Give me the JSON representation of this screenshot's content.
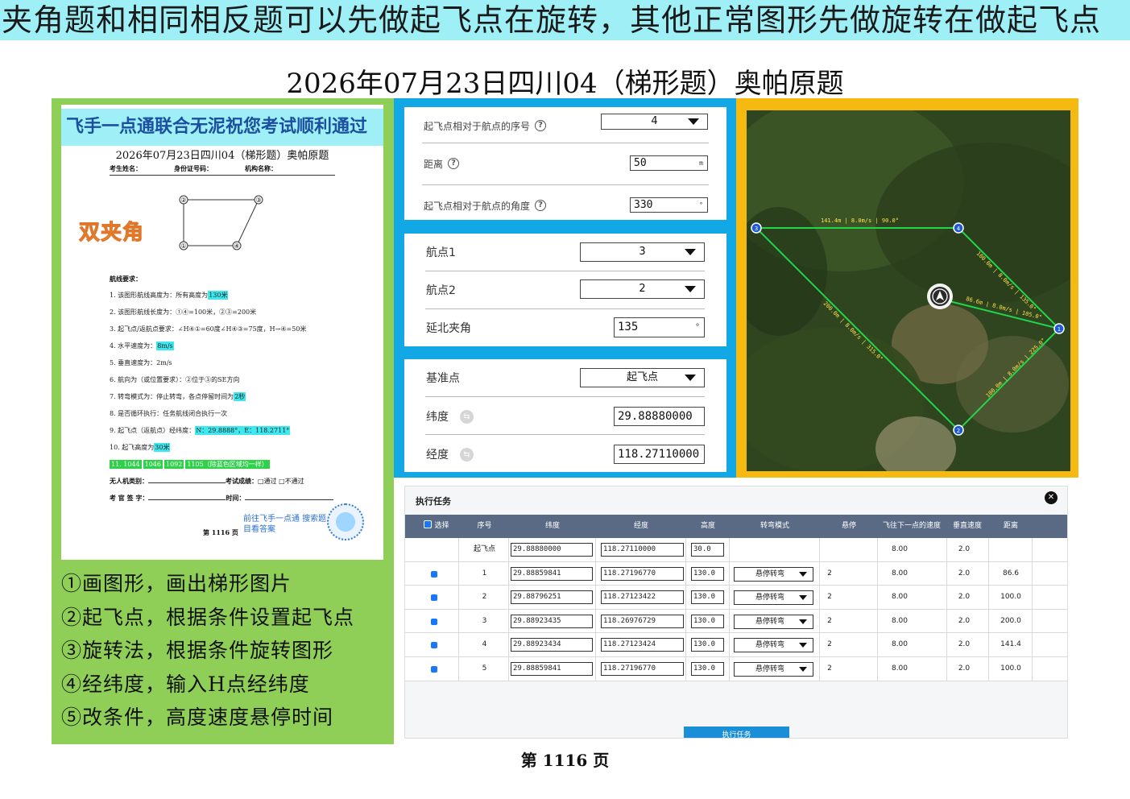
{
  "banner": "夹角题和相同相反题可以先做起飞点在旋转，其他正常图形先做旋转在做起飞点",
  "main_title": "2026年07月23日四川04（梯形题）奥帕原题",
  "doc": {
    "header": "飞手一点通联合无泥祝您考试顺利通过",
    "title": "2026年07月23日四川04（梯形题）奥帕原题",
    "field_name": "考生姓名：",
    "field_id": "身份证号码：",
    "field_org": "机构名称：",
    "badge": "双夹角",
    "shape_labels": [
      "②",
      "③",
      "①",
      "④"
    ],
    "req_title": "航线要求：",
    "req": {
      "r1_a": "1.  该图形航线高度为：所有高度为",
      "r1_hl": "130米",
      "r2": "2.  该图形航线长度为：①④=100米，②③=200米",
      "r3": "3.  起飞点/返航点要求：∠H④①=60度∠H④③=75度，H→④=50米",
      "r4_a": "4.  水平速度为：",
      "r4_hl": "8m/s",
      "r5": "5.  垂直速度为：2m/s",
      "r6": "6.  航向为（或位置要求）：②位于③的SE方向",
      "r7_a": "7.  转弯模式为：停止转弯，各点停留时间为",
      "r7_hl": "2秒",
      "r8": "8.  是否循环执行：任务航线闭合执行一次",
      "r9_a": "9.  起飞点（返航点）经纬度：",
      "r9_hl": "N：29.8888°，E：118.2711°",
      "r10_a": "10. 起飞高度为",
      "r10_hl": "30米",
      "r11": [
        "11. 1044",
        "1046",
        "1092",
        "1105（除蓝色区域均一样）"
      ]
    },
    "sign1_a": "无人机类别：",
    "sign1_b": "考试成绩：",
    "sign1_c": "□通过  □不通过",
    "sign2_a": "考 官 签 字：",
    "sign2_b": "时间：",
    "page_label": "第 1116 页",
    "link_text": "前往飞手一点通 搜索题目看答案"
  },
  "steps": [
    "①画图形，画出梯形图片",
    "②起飞点，根据条件设置起飞点",
    "③旋转法，根据条件旋转图形",
    "④经纬度，输入H点经纬度",
    "⑤改条件，高度速度悬停时间"
  ],
  "panel1": {
    "seq_label": "起飞点相对于航点的序号",
    "seq_value": "4",
    "dist_label": "距离",
    "dist_value": "50",
    "dist_unit": "m",
    "angle_label": "起飞点相对于航点的角度",
    "angle_value": "330",
    "angle_unit": "°"
  },
  "panel2": {
    "wp1_label": "航点1",
    "wp1_value": "3",
    "wp2_label": "航点2",
    "wp2_value": "2",
    "north_label": "延北夹角",
    "north_value": "135",
    "north_unit": "°"
  },
  "panel3": {
    "base_label": "基准点",
    "base_value": "起飞点",
    "lat_label": "纬度",
    "lat_value": "29.88880000",
    "lon_label": "经度",
    "lon_value": "118.27110000"
  },
  "map": {
    "labels": {
      "e34": "141.4m | 8.0m/s | 90.0°",
      "e41": "100.0m | 8.0m/s | 135.0°",
      "eH1": "86.6m | 8.0m/s | 105.0°",
      "e32": "200.0m | 8.0m/s | 315.0°",
      "e21": "100.0m | 8.0m/s | 225.0°"
    },
    "nodes": [
      "3",
      "4",
      "1",
      "2"
    ]
  },
  "task": {
    "title": "执行任务",
    "close": "✕",
    "headers": [
      "选择",
      "序号",
      "纬度",
      "经度",
      "高度",
      "转弯模式",
      "悬停",
      "飞往下一点的速度",
      "垂直速度",
      "距离"
    ],
    "rows": [
      {
        "seq": "起飞点",
        "lat": "29.88880000",
        "lon": "118.27110000",
        "alt": "30.0",
        "mode": "",
        "hover": "",
        "speed": "8.00",
        "vspeed": "2.0",
        "dist": ""
      },
      {
        "seq": "1",
        "lat": "29.88859841",
        "lon": "118.27196770",
        "alt": "130.0",
        "mode": "悬停转弯",
        "hover": "2",
        "speed": "8.00",
        "vspeed": "2.0",
        "dist": "86.6"
      },
      {
        "seq": "2",
        "lat": "29.88796251",
        "lon": "118.27123422",
        "alt": "130.0",
        "mode": "悬停转弯",
        "hover": "2",
        "speed": "8.00",
        "vspeed": "2.0",
        "dist": "100.0"
      },
      {
        "seq": "3",
        "lat": "29.88923435",
        "lon": "118.26976729",
        "alt": "130.0",
        "mode": "悬停转弯",
        "hover": "2",
        "speed": "8.00",
        "vspeed": "2.0",
        "dist": "200.0"
      },
      {
        "seq": "4",
        "lat": "29.88923434",
        "lon": "118.27123424",
        "alt": "130.0",
        "mode": "悬停转弯",
        "hover": "2",
        "speed": "8.00",
        "vspeed": "2.0",
        "dist": "141.4"
      },
      {
        "seq": "5",
        "lat": "29.88859841",
        "lon": "118.27196770",
        "alt": "130.0",
        "mode": "悬停转弯",
        "hover": "2",
        "speed": "8.00",
        "vspeed": "2.0",
        "dist": "100.0"
      }
    ],
    "exec_button": "执行任务"
  },
  "page_number": "第 1116 页",
  "colors": {
    "banner_bg": "#9ff0f6",
    "green": "#8fcf57",
    "blue": "#12a8e6",
    "gold": "#f5b90f",
    "route": "#22d64a"
  }
}
